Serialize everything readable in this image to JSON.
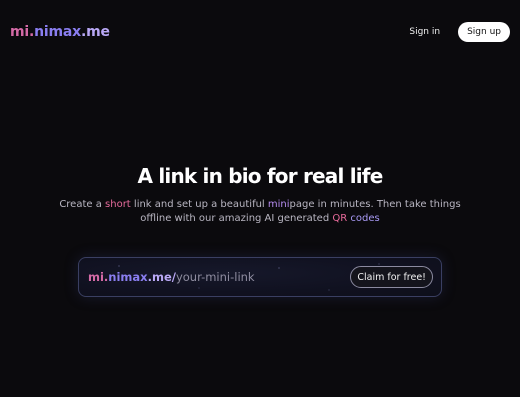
{
  "header": {
    "logo": {
      "part1": "mi.",
      "part2": "nimax",
      "part3": ".me"
    },
    "sign_in_label": "Sign in",
    "sign_up_label": "Sign up"
  },
  "hero": {
    "title": "A link in bio for real life",
    "subtitle": {
      "t1": "Create a ",
      "h1": "short",
      "t2": " link and set up a beautiful ",
      "h2": "mini",
      "t3": "page in minutes. Then take things",
      "t4": "offline with our amazing AI generated ",
      "h3": "QR",
      "t5": " ",
      "h4": "codes"
    }
  },
  "claim": {
    "prefix": {
      "part1": "mi.",
      "part2": "nimax",
      "part3": ".me/"
    },
    "input_value": "",
    "placeholder": "your-mini-link",
    "button_label": "Claim for free!"
  },
  "colors": {
    "background": "#0b0a0d",
    "accent_pink": "#d46aa6",
    "accent_purple": "#8a7ef0"
  }
}
